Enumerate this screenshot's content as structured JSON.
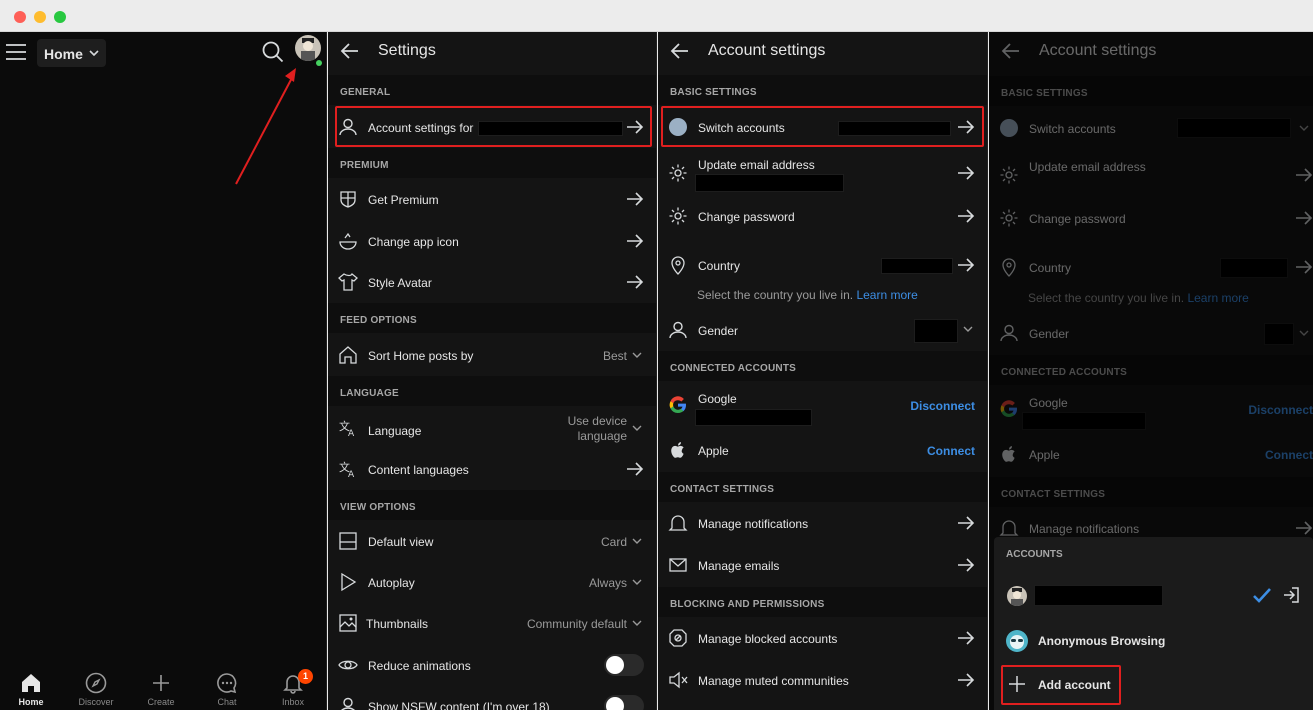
{
  "titlebar": {
    "colors": {
      "close": "#fe5f57",
      "minimize": "#febc2e",
      "zoom": "#28c840"
    }
  },
  "home": {
    "dropdown_label": "Home",
    "nav": [
      {
        "label": "Home",
        "icon": "home-icon",
        "active": true
      },
      {
        "label": "Discover",
        "icon": "compass-icon"
      },
      {
        "label": "Create",
        "icon": "plus-icon"
      },
      {
        "label": "Chat",
        "icon": "chat-icon"
      },
      {
        "label": "Inbox",
        "icon": "bell-icon",
        "badge": "1"
      }
    ]
  },
  "settings": {
    "title": "Settings",
    "sections": {
      "general": "GENERAL",
      "premium": "PREMIUM",
      "feed": "FEED OPTIONS",
      "language": "LANGUAGE",
      "view": "VIEW OPTIONS"
    },
    "rows": {
      "account_settings": "Account settings for",
      "get_premium": "Get Premium",
      "change_app_icon": "Change app icon",
      "style_avatar": "Style Avatar",
      "sort_home": "Sort Home posts by",
      "sort_home_value": "Best",
      "language": "Language",
      "language_value_1": "Use device",
      "language_value_2": "language",
      "content_languages": "Content languages",
      "default_view": "Default view",
      "default_view_value": "Card",
      "autoplay": "Autoplay",
      "autoplay_value": "Always",
      "thumbnails": "Thumbnails",
      "thumbnails_value": "Community default",
      "reduce_animations": "Reduce animations",
      "nsfw": "Show NSFW content (I'm over 18)"
    }
  },
  "account": {
    "title": "Account settings",
    "sections": {
      "basic": "BASIC SETTINGS",
      "connected": "CONNECTED ACCOUNTS",
      "contact": "CONTACT SETTINGS",
      "blocking": "BLOCKING AND PERMISSIONS"
    },
    "rows": {
      "switch_accounts": "Switch accounts",
      "update_email": "Update email address",
      "change_password": "Change password",
      "country": "Country",
      "country_sub": "Select the country you live in.",
      "learn_more": "Learn more",
      "gender": "Gender",
      "google": "Google",
      "disconnect": "Disconnect",
      "apple": "Apple",
      "connect": "Connect",
      "manage_notifications": "Manage notifications",
      "manage_emails": "Manage emails",
      "manage_blocked": "Manage blocked accounts",
      "manage_muted": "Manage muted communities"
    }
  },
  "accounts_sheet": {
    "title": "ACCOUNTS",
    "anonymous": "Anonymous Browsing",
    "add_account": "Add account"
  },
  "colors": {
    "highlight": "#e01f1f",
    "link": "#3d8ee4",
    "check": "#3d8ee4"
  }
}
